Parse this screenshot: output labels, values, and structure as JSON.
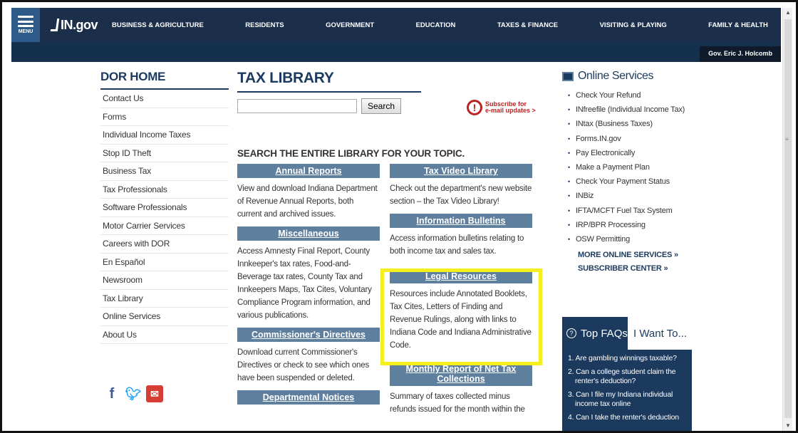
{
  "nav": {
    "menu_label": "MENU",
    "logo": "IN.gov",
    "items": [
      "BUSINESS & AGRICULTURE",
      "RESIDENTS",
      "GOVERNMENT",
      "EDUCATION",
      "TAXES & FINANCE",
      "VISITING & PLAYING",
      "FAMILY & HEALTH"
    ],
    "governor": "Gov. Eric J. Holcomb"
  },
  "sidebar": {
    "title": "DOR HOME",
    "items": [
      "Contact Us",
      "Forms",
      "Individual Income Taxes",
      "Stop ID Theft",
      "Business Tax",
      "Tax Professionals",
      "Software Professionals",
      "Motor Carrier Services",
      "Careers with DOR",
      "En Español",
      "Newsroom",
      "Tax Library",
      "Online Services",
      "About Us"
    ],
    "social": [
      "facebook-icon",
      "twitter-icon",
      "email-share-icon"
    ]
  },
  "main": {
    "title": "TAX LIBRARY",
    "search_value": "",
    "search_button": "Search",
    "subscribe_line1": "Subscribe for",
    "subscribe_line2": "e-mail updates >",
    "search_heading": "SEARCH THE ENTIRE LIBRARY FOR YOUR TOPIC.",
    "col_a": [
      {
        "title": "Annual Reports",
        "desc": "View and download Indiana Department of Revenue Annual Reports, both current and archived issues."
      },
      {
        "title": "Miscellaneous",
        "desc": "Access Amnesty Final Report, County Innkeeper's tax rates, Food-and-Beverage tax rates, County Tax and Innkeepers Maps, Tax Cites, Voluntary Compliance Program information, and various publications."
      },
      {
        "title": "Commissioner's Directives",
        "desc": "Download current Commissioner's Directives or check to see which ones have been suspended or deleted."
      },
      {
        "title": "Departmental Notices",
        "desc": ""
      }
    ],
    "col_b": [
      {
        "title": "Tax Video Library",
        "desc": "Check out the department's new website section – the Tax Video Library!"
      },
      {
        "title": "Information Bulletins",
        "desc": "Access information bulletins relating to both income tax and sales tax."
      },
      {
        "title": "Legal Resources",
        "desc": "Resources include Annotated Booklets, Tax Cites, Letters of Finding and Revenue Rulings, along with links to Indiana Code and Indiana Administrative Code."
      },
      {
        "title": "Monthly Report of Net Tax Collections",
        "desc": "Summary of taxes collected minus refunds issued for the month within the"
      }
    ]
  },
  "right": {
    "title": "Online Services",
    "items": [
      "Check Your Refund",
      "INfreefile (Individual Income Tax)",
      "INtax (Business Taxes)",
      "Forms.IN.gov",
      "Pay Electronically",
      "Make a Payment Plan",
      "Check Your Payment Status",
      "INBiz",
      "IFTA/MCFT Fuel Tax System",
      "IRP/BPR Processing",
      "OSW Permitting"
    ],
    "more": "MORE ONLINE SERVICES »",
    "subscriber": "SUBSCRIBER CENTER »",
    "faq_tab": "Top FAQs",
    "want_tab": "I Want To...",
    "faqs": [
      "1. Are gambling winnings taxable?",
      "2. Can a college student claim the renter's deduction?",
      "3. Can I file my Indiana individual income tax online",
      "4. Can I take the renter's deduction"
    ]
  },
  "colors": {
    "nav_bg": "#1c2f4a",
    "accent": "#1c3a5e",
    "category": "#5f7f9e",
    "highlight": "#f5ef1d",
    "alert": "#b22222"
  }
}
